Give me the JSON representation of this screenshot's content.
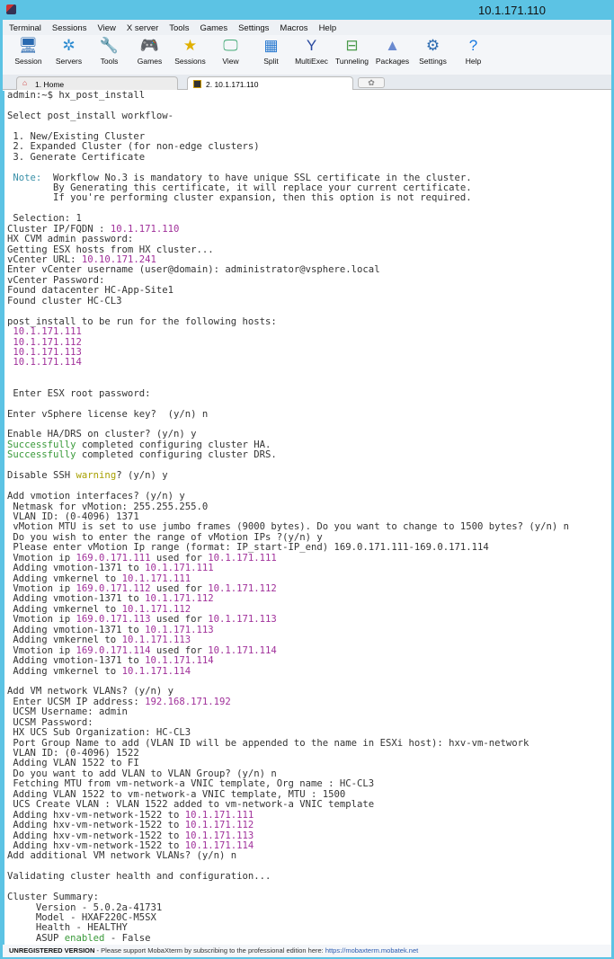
{
  "window": {
    "title": "10.1.171.110"
  },
  "menu": [
    "Terminal",
    "Sessions",
    "View",
    "X server",
    "Tools",
    "Games",
    "Settings",
    "Macros",
    "Help"
  ],
  "toolbar": [
    {
      "label": "Session",
      "icon": "session-icon",
      "glyph": "🖥"
    },
    {
      "label": "Servers",
      "icon": "servers-icon",
      "glyph": "✲"
    },
    {
      "label": "Tools",
      "icon": "tools-icon",
      "glyph": "🔧"
    },
    {
      "label": "Games",
      "icon": "games-icon",
      "glyph": "🎮"
    },
    {
      "label": "Sessions",
      "icon": "star-icon",
      "glyph": "★"
    },
    {
      "label": "View",
      "icon": "view-icon",
      "glyph": "🖵"
    },
    {
      "label": "Split",
      "icon": "split-icon",
      "glyph": "▦"
    },
    {
      "label": "MultiExec",
      "icon": "multiexec-icon",
      "glyph": "Y"
    },
    {
      "label": "Tunneling",
      "icon": "tunneling-icon",
      "glyph": "⊟"
    },
    {
      "label": "Packages",
      "icon": "packages-icon",
      "glyph": "▲"
    },
    {
      "label": "Settings",
      "icon": "gears-icon",
      "glyph": "⚙"
    },
    {
      "label": "Help",
      "icon": "help-icon",
      "glyph": "?"
    }
  ],
  "tabs": [
    {
      "label": "1. Home"
    },
    {
      "label": "2. 10.1.171.110"
    }
  ],
  "colors": {
    "ip": "#a0309a",
    "ok": "#3a9a3a",
    "note": "#3a90a8",
    "warn": "#a8a000",
    "titlebar": "#5cc3e4"
  },
  "terminal": {
    "lines": [
      [
        [
          "admin:~$ hx_post_install",
          ""
        ]
      ],
      [],
      [
        [
          "Select post_install workflow-",
          ""
        ]
      ],
      [],
      [
        [
          " 1. New/Existing Cluster",
          ""
        ]
      ],
      [
        [
          " 2. Expanded Cluster (for non-edge clusters)",
          ""
        ]
      ],
      [
        [
          " 3. Generate Certificate",
          ""
        ]
      ],
      [],
      [
        [
          " ",
          ""
        ],
        [
          "Note:",
          "note"
        ],
        [
          "  Workflow No.3 is mandatory to have unique SSL certificate in the cluster.",
          ""
        ]
      ],
      [
        [
          "        By Generating this certificate, it will replace your current certificate.",
          ""
        ]
      ],
      [
        [
          "        If you're performing cluster expansion, then this option is not required.",
          ""
        ]
      ],
      [],
      [
        [
          " Selection: 1",
          ""
        ]
      ],
      [
        [
          "Cluster IP/FQDN : ",
          ""
        ],
        [
          "10.1.171.110",
          "ip"
        ]
      ],
      [
        [
          "HX CVM admin password:",
          ""
        ]
      ],
      [
        [
          "Getting ESX hosts from HX cluster...",
          ""
        ]
      ],
      [
        [
          "vCenter URL: ",
          ""
        ],
        [
          "10.10.171.241",
          "ip"
        ]
      ],
      [
        [
          "Enter vCenter username (user@domain): administrator@vsphere.local",
          ""
        ]
      ],
      [
        [
          "vCenter Password:",
          ""
        ]
      ],
      [
        [
          "Found datacenter HC-App-Site1",
          ""
        ]
      ],
      [
        [
          "Found cluster HC-CL3",
          ""
        ]
      ],
      [],
      [
        [
          "post_install to be run for the following hosts:",
          ""
        ]
      ],
      [
        [
          " ",
          ""
        ],
        [
          "10.1.171.111",
          "ip"
        ]
      ],
      [
        [
          " ",
          ""
        ],
        [
          "10.1.171.112",
          "ip"
        ]
      ],
      [
        [
          " ",
          ""
        ],
        [
          "10.1.171.113",
          "ip"
        ]
      ],
      [
        [
          " ",
          ""
        ],
        [
          "10.1.171.114",
          "ip"
        ]
      ],
      [],
      [],
      [
        [
          " Enter ESX root password:",
          ""
        ]
      ],
      [],
      [
        [
          "Enter vSphere license key?  (y/n) n",
          ""
        ]
      ],
      [],
      [
        [
          "Enable HA/DRS on cluster? (y/n) y",
          ""
        ]
      ],
      [
        [
          "Successfully",
          "ok"
        ],
        [
          " completed configuring cluster HA.",
          ""
        ]
      ],
      [
        [
          "Successfully",
          "ok"
        ],
        [
          " completed configuring cluster DRS.",
          ""
        ]
      ],
      [],
      [
        [
          "Disable SSH ",
          ""
        ],
        [
          "warning",
          "warn"
        ],
        [
          "? (y/n) y",
          ""
        ]
      ],
      [],
      [
        [
          "Add vmotion interfaces? (y/n) y",
          ""
        ]
      ],
      [
        [
          " Netmask for vMotion: 255.255.255.0",
          ""
        ]
      ],
      [
        [
          " VLAN ID: (0-4096) 1371",
          ""
        ]
      ],
      [
        [
          " vMotion MTU is set to use jumbo frames (9000 bytes). Do you want to change to 1500 bytes? (y/n) n",
          ""
        ]
      ],
      [
        [
          " Do you wish to enter the range of vMotion IPs ?(y/n) y",
          ""
        ]
      ],
      [
        [
          " Please enter vMotion Ip range (format: IP_start-IP_end) 169.0.171.111-169.0.171.114",
          ""
        ]
      ],
      [
        [
          " Vmotion ip ",
          ""
        ],
        [
          "169.0.171.111",
          "ip"
        ],
        [
          " used for ",
          ""
        ],
        [
          "10.1.171.111",
          "ip"
        ]
      ],
      [
        [
          " Adding vmotion-1371 to ",
          ""
        ],
        [
          "10.1.171.111",
          "ip"
        ]
      ],
      [
        [
          " Adding vmkernel to ",
          ""
        ],
        [
          "10.1.171.111",
          "ip"
        ]
      ],
      [
        [
          " Vmotion ip ",
          ""
        ],
        [
          "169.0.171.112",
          "ip"
        ],
        [
          " used for ",
          ""
        ],
        [
          "10.1.171.112",
          "ip"
        ]
      ],
      [
        [
          " Adding vmotion-1371 to ",
          ""
        ],
        [
          "10.1.171.112",
          "ip"
        ]
      ],
      [
        [
          " Adding vmkernel to ",
          ""
        ],
        [
          "10.1.171.112",
          "ip"
        ]
      ],
      [
        [
          " Vmotion ip ",
          ""
        ],
        [
          "169.0.171.113",
          "ip"
        ],
        [
          " used for ",
          ""
        ],
        [
          "10.1.171.113",
          "ip"
        ]
      ],
      [
        [
          " Adding vmotion-1371 to ",
          ""
        ],
        [
          "10.1.171.113",
          "ip"
        ]
      ],
      [
        [
          " Adding vmkernel to ",
          ""
        ],
        [
          "10.1.171.113",
          "ip"
        ]
      ],
      [
        [
          " Vmotion ip ",
          ""
        ],
        [
          "169.0.171.114",
          "ip"
        ],
        [
          " used for ",
          ""
        ],
        [
          "10.1.171.114",
          "ip"
        ]
      ],
      [
        [
          " Adding vmotion-1371 to ",
          ""
        ],
        [
          "10.1.171.114",
          "ip"
        ]
      ],
      [
        [
          " Adding vmkernel to ",
          ""
        ],
        [
          "10.1.171.114",
          "ip"
        ]
      ],
      [],
      [
        [
          "Add VM network VLANs? (y/n) y",
          ""
        ]
      ],
      [
        [
          " Enter UCSM IP address: ",
          ""
        ],
        [
          "192.168.171.192",
          "ip"
        ]
      ],
      [
        [
          " UCSM Username: admin",
          ""
        ]
      ],
      [
        [
          " UCSM Password:",
          ""
        ]
      ],
      [
        [
          " HX UCS Sub Organization: HC-CL3",
          ""
        ]
      ],
      [
        [
          " Port Group Name to add (VLAN ID will be appended to the name in ESXi host): hxv-vm-network",
          ""
        ]
      ],
      [
        [
          " VLAN ID: (0-4096) 1522",
          ""
        ]
      ],
      [
        [
          " Adding VLAN 1522 to FI",
          ""
        ]
      ],
      [
        [
          " Do you want to add VLAN to VLAN Group? (y/n) n",
          ""
        ]
      ],
      [
        [
          " Fetching MTU from vm-network-a VNIC template, Org name : HC-CL3",
          ""
        ]
      ],
      [
        [
          " Adding VLAN 1522 to vm-network-a VNIC template, MTU : 1500",
          ""
        ]
      ],
      [
        [
          " UCS Create VLAN : VLAN 1522 added to vm-network-a VNIC template",
          ""
        ]
      ],
      [
        [
          " Adding hxv-vm-network-1522 to ",
          ""
        ],
        [
          "10.1.171.111",
          "ip"
        ]
      ],
      [
        [
          " Adding hxv-vm-network-1522 to ",
          ""
        ],
        [
          "10.1.171.112",
          "ip"
        ]
      ],
      [
        [
          " Adding hxv-vm-network-1522 to ",
          ""
        ],
        [
          "10.1.171.113",
          "ip"
        ]
      ],
      [
        [
          " Adding hxv-vm-network-1522 to ",
          ""
        ],
        [
          "10.1.171.114",
          "ip"
        ]
      ],
      [
        [
          "Add additional VM network VLANs? (y/n) n",
          ""
        ]
      ],
      [],
      [
        [
          "Validating cluster health and configuration...",
          ""
        ]
      ],
      [],
      [
        [
          "Cluster Summary:",
          ""
        ]
      ],
      [
        [
          "     Version - 5.0.2a-41731",
          ""
        ]
      ],
      [
        [
          "     Model - HXAF220C-M5SX",
          ""
        ]
      ],
      [
        [
          "     Health - HEALTHY",
          ""
        ]
      ],
      [
        [
          "     ASUP ",
          ""
        ],
        [
          "enabled",
          "ok"
        ],
        [
          " - False",
          ""
        ]
      ]
    ]
  },
  "status": {
    "bold": "UNREGISTERED VERSION",
    "text": "  -  Please support MobaXterm by subscribing to the professional edition here:  ",
    "link": "https://mobaxterm.mobatek.net"
  }
}
